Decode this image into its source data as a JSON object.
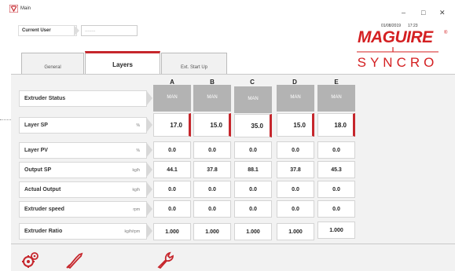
{
  "window": {
    "title": "Main",
    "date": "01/08/2019",
    "time": "17:23",
    "minimize": "–",
    "maximize": "□",
    "close": "✕"
  },
  "user": {
    "label": "Current User",
    "value": "--------"
  },
  "logo": {
    "brand": "MAGUIRE",
    "registered": "®",
    "product": "SYNCRO"
  },
  "tabs": [
    {
      "label": "General"
    },
    {
      "label": "Layers"
    },
    {
      "label": "Ext. Start Up"
    }
  ],
  "columns": [
    "A",
    "B",
    "C",
    "D",
    "E"
  ],
  "rows": [
    {
      "label": "Extruder Status",
      "unit": "",
      "values": [
        "MAN",
        "MAN",
        "MAN",
        "MAN",
        "MAN"
      ]
    },
    {
      "label": "Layer SP",
      "unit": "%",
      "values": [
        "17.0",
        "15.0",
        "35.0",
        "15.0",
        "18.0"
      ]
    },
    {
      "label": "Layer PV",
      "unit": "%",
      "values": [
        "0.0",
        "0.0",
        "0.0",
        "0.0",
        "0.0"
      ]
    },
    {
      "label": "Output SP",
      "unit": "kg/h",
      "values": [
        "44.1",
        "37.8",
        "88.1",
        "37.8",
        "45.3"
      ]
    },
    {
      "label": "Actual Output",
      "unit": "kg/h",
      "values": [
        "0.0",
        "0.0",
        "0.0",
        "0.0",
        "0.0"
      ]
    },
    {
      "label": "Extruder speed",
      "unit": "rpm",
      "values": [
        "0.0",
        "0.0",
        "0.0",
        "0.0",
        "0.0"
      ]
    },
    {
      "label": "Extruder Ratio",
      "unit": "kg/h/rpm",
      "values": [
        "1.000",
        "1.000",
        "1.000",
        "1.000",
        "1.000"
      ]
    }
  ],
  "tools": [
    {
      "icon": "gears-icon"
    },
    {
      "icon": "calibrate-icon"
    },
    {
      "icon": "wrench-icon"
    }
  ],
  "colors": {
    "accent": "#c6262c",
    "status_bg": "#b3b3b3"
  }
}
